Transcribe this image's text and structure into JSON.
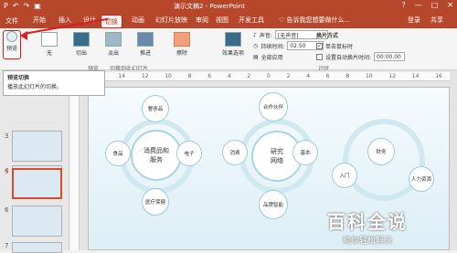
{
  "titlebar": {
    "title": "演示文稿2 - PowerPoint",
    "qat": [
      "P",
      "↶",
      "↷",
      "▣"
    ],
    "window_buttons": [
      "?",
      "—",
      "□",
      "✕"
    ]
  },
  "tabs": {
    "file": "文件",
    "home": "开始",
    "insert": "插入",
    "design": "设计",
    "transitions": "切换",
    "animations": "动画",
    "slideshow": "幻灯片放映",
    "review": "审阅",
    "view": "视图",
    "developer": "开发工具",
    "tell_me": "♡ 告诉我您想要做什么...",
    "login": "登录",
    "share": "共享"
  },
  "ribbon": {
    "preview": "预览",
    "none": "无",
    "cut": "切出",
    "fade": "淡出",
    "push": "推进",
    "wipe": "擦除",
    "effect_options": "效果选项",
    "group_preview": "预览",
    "group_transition": "切换到此幻灯片",
    "group_timing": "计时",
    "sound_label": "声音:",
    "sound_value": "[无声音]",
    "duration_label": "持续时间:",
    "duration_value": "02.50",
    "apply_all": "全部应用",
    "advance_title": "换片方式",
    "on_click": "单击鼠标时",
    "after_label": "设置自动换片时间:",
    "after_value": "00:00.00"
  },
  "tooltip": {
    "title": "预览切换",
    "body": "播放此幻灯片的切换。"
  },
  "thumbnails": [
    {
      "num": "3"
    },
    {
      "num": "4"
    },
    {
      "num": "5",
      "selected": true
    },
    {
      "num": "6"
    },
    {
      "num": "7"
    }
  ],
  "ruler_ticks": [
    "16",
    "14",
    "12",
    "10",
    "8",
    "6",
    "4",
    "2",
    "0",
    "2",
    "4",
    "6",
    "8",
    "10",
    "12",
    "14",
    "16"
  ],
  "slide": {
    "left_center": "消费品和\n服务",
    "left_sats": [
      "奢侈品",
      "电子",
      "医疗保健",
      "食品"
    ],
    "mid_center": "研究\n网络",
    "mid_sats": [
      "合作伙伴",
      "基本",
      "品牌智能",
      "消费"
    ],
    "right_sats": [
      "财务",
      "入门",
      "人力资源"
    ]
  },
  "watermark": {
    "big": "百科全说",
    "small": "助你轻松解决"
  }
}
